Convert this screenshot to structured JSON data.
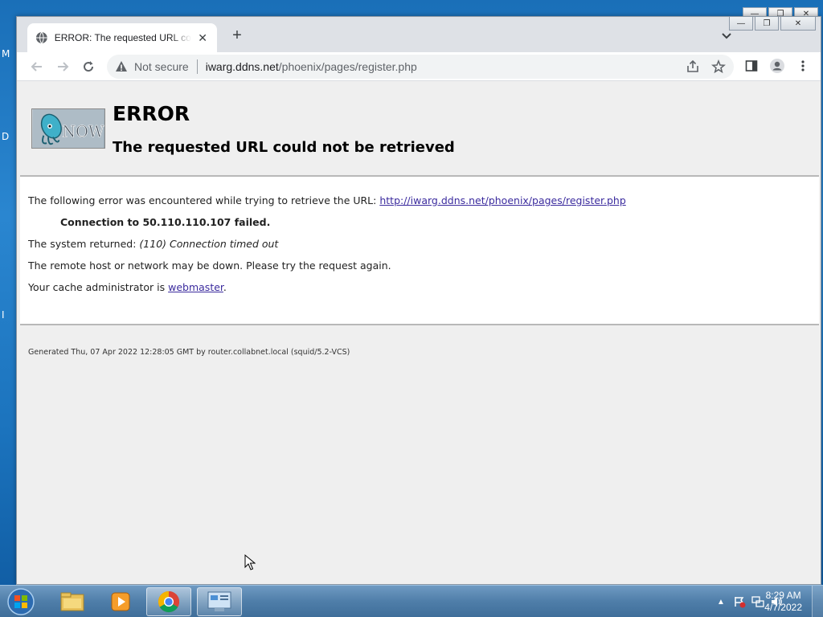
{
  "desktop": {
    "letters": [
      "M",
      "D",
      "I"
    ]
  },
  "browser": {
    "tab": {
      "title": "ERROR: The requested URL could not be retrieved",
      "close": "✕"
    },
    "new_tab": "+",
    "window_controls": {
      "minimize": "—",
      "maximize": "❐",
      "close": "✕"
    },
    "address": {
      "security_label": "Not secure",
      "host": "iwarg.ddns.net",
      "path": "/phoenix/pages/register.php"
    }
  },
  "page": {
    "title": "ERROR",
    "subtitle": "The requested URL could not be retrieved",
    "line1_prefix": "The following error was encountered while trying to retrieve the URL: ",
    "line1_link": "http://iwarg.ddns.net/phoenix/pages/register.php",
    "line2": "Connection to 50.110.110.107 failed.",
    "line3_prefix": "The system returned: ",
    "line3_em": "(110) Connection timed out",
    "line4": "The remote host or network may be down. Please try the request again.",
    "line5_prefix": "Your cache administrator is ",
    "line5_link": "webmaster",
    "line5_suffix": ".",
    "footer": "Generated Thu, 07 Apr 2022 12:28:05 GMT by router.collabnet.local (squid/5.2-VCS)"
  },
  "taskbar": {
    "apps": [
      "file-explorer",
      "media-player",
      "chrome",
      "control-panel"
    ],
    "clock_time": "8:29 AM",
    "clock_date": "4/7/2022"
  }
}
